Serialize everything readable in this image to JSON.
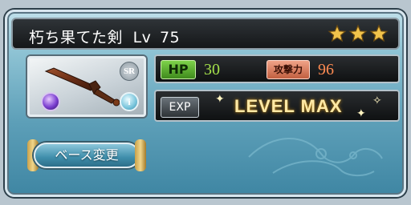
{
  "item": {
    "name": "朽ち果てた剣",
    "level_label": "Lv",
    "level": "75",
    "rarity": "SR",
    "stars": 3
  },
  "stats": {
    "hp_label": "HP",
    "hp_value": "30",
    "atk_label": "攻撃力",
    "atk_value": "96",
    "exp_label": "EXP",
    "exp_status": "LEVEL MAX"
  },
  "buttons": {
    "base_change": "ベース変更"
  },
  "icons": {
    "element_orb": "dark-element-orb-icon",
    "info": "info-icon",
    "info_glyph": "i"
  },
  "colors": {
    "hp": "#7dd24a",
    "atk": "#ff8b52",
    "level_max": "#ffe9a6"
  }
}
